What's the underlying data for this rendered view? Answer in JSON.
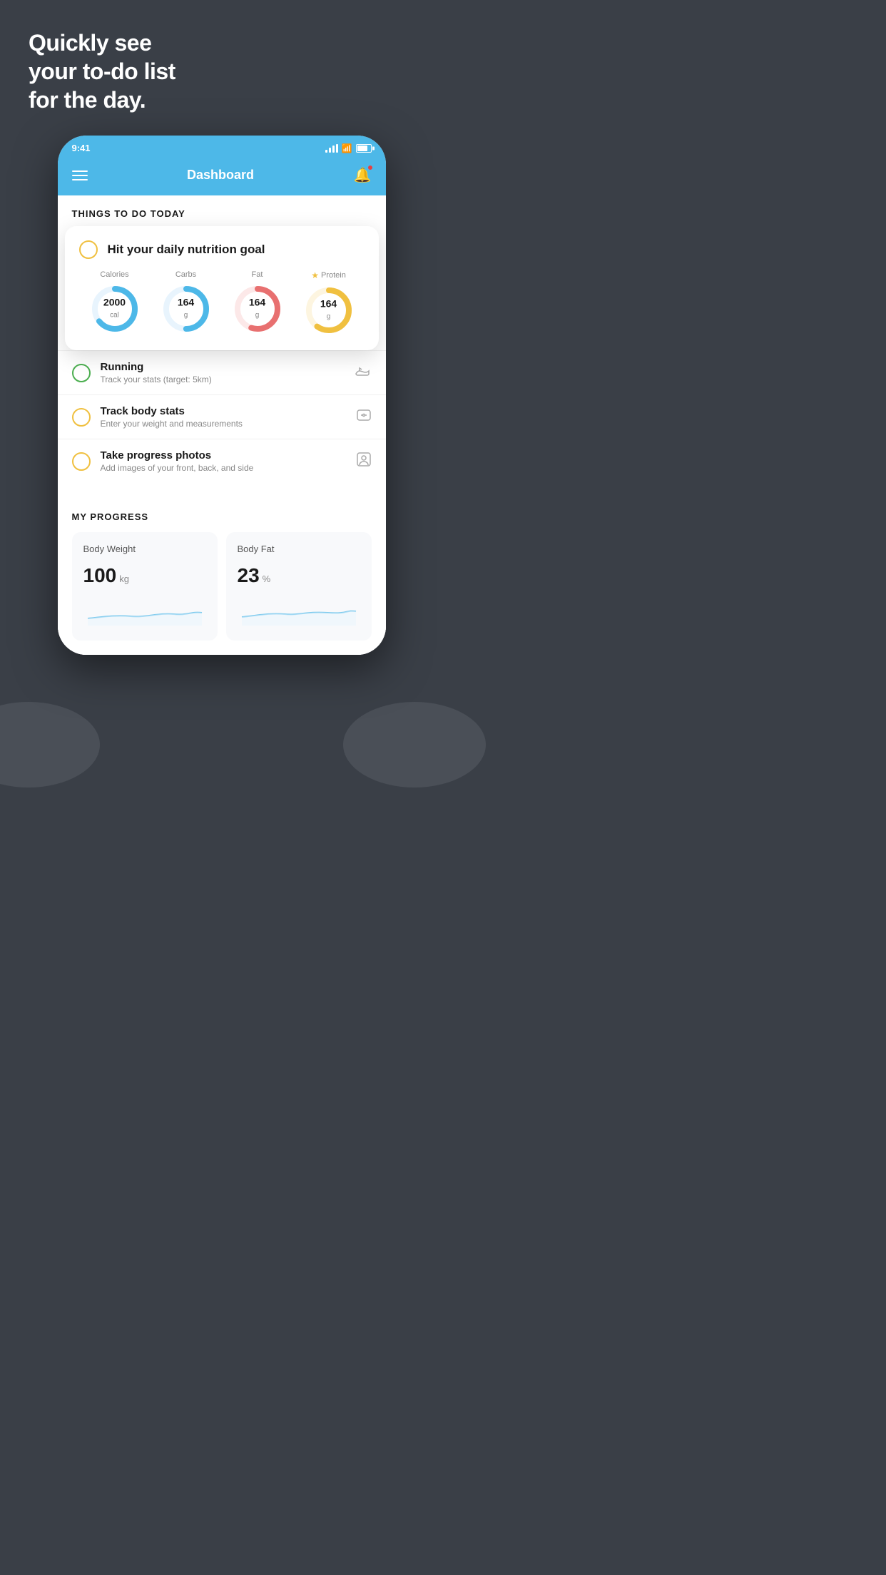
{
  "hero": {
    "line1": "Quickly see",
    "line2": "your to-do list",
    "line3": "for the day."
  },
  "status_bar": {
    "time": "9:41"
  },
  "header": {
    "title": "Dashboard"
  },
  "things_to_do": {
    "heading": "THINGS TO DO TODAY"
  },
  "nutrition_card": {
    "title": "Hit your daily nutrition goal",
    "items": [
      {
        "label": "Calories",
        "value": "2000",
        "unit": "cal",
        "color": "#4db8e8",
        "pct": 65,
        "star": false
      },
      {
        "label": "Carbs",
        "value": "164",
        "unit": "g",
        "color": "#4db8e8",
        "pct": 50,
        "star": false
      },
      {
        "label": "Fat",
        "value": "164",
        "unit": "g",
        "color": "#e87070",
        "pct": 55,
        "star": false
      },
      {
        "label": "Protein",
        "value": "164",
        "unit": "g",
        "color": "#f0c040",
        "pct": 60,
        "star": true
      }
    ]
  },
  "todo_items": [
    {
      "title": "Running",
      "subtitle": "Track your stats (target: 5km)",
      "icon": "shoe",
      "radio_color": "green"
    },
    {
      "title": "Track body stats",
      "subtitle": "Enter your weight and measurements",
      "icon": "scale",
      "radio_color": "yellow"
    },
    {
      "title": "Take progress photos",
      "subtitle": "Add images of your front, back, and side",
      "icon": "person",
      "radio_color": "yellow"
    }
  ],
  "my_progress": {
    "heading": "MY PROGRESS",
    "cards": [
      {
        "title": "Body Weight",
        "value": "100",
        "unit": "kg"
      },
      {
        "title": "Body Fat",
        "value": "23",
        "unit": "%"
      }
    ]
  }
}
